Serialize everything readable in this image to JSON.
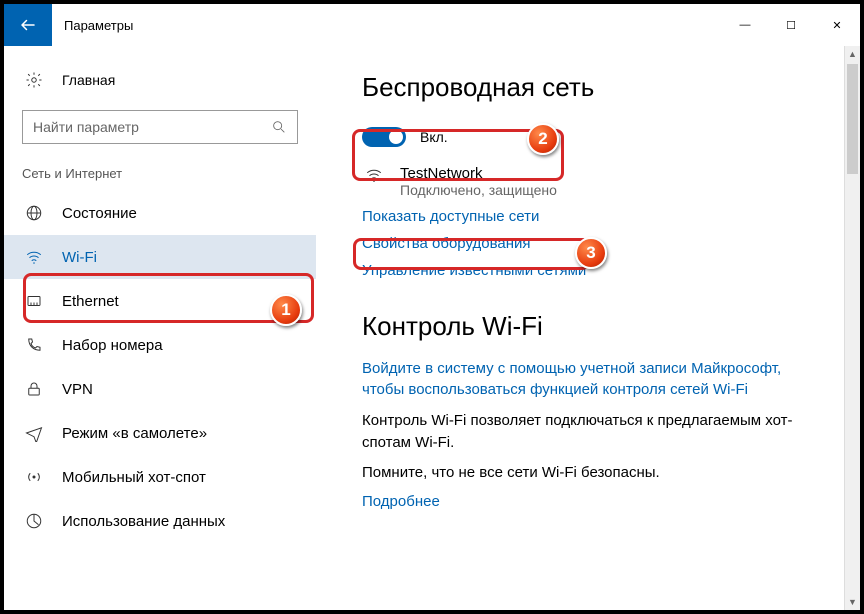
{
  "titlebar": {
    "title": "Параметры"
  },
  "sidebar": {
    "home": "Главная",
    "search_placeholder": "Найти параметр",
    "section": "Сеть и Интернет",
    "items": [
      {
        "label": "Состояние"
      },
      {
        "label": "Wi-Fi"
      },
      {
        "label": "Ethernet"
      },
      {
        "label": "Набор номера"
      },
      {
        "label": "VPN"
      },
      {
        "label": "Режим «в самолете»"
      },
      {
        "label": "Мобильный хот-спот"
      },
      {
        "label": "Использование данных"
      }
    ]
  },
  "main": {
    "heading": "Беспроводная сеть",
    "toggle_label": "Вкл.",
    "network": {
      "name": "TestNetwork",
      "status": "Подключено, защищено"
    },
    "link_available": "Показать доступные сети",
    "link_hardware": "Свойства оборудования",
    "link_known": "Управление известными сетями",
    "heading2": "Контроль Wi-Fi",
    "link_signin": "Войдите в систему с помощью учетной записи Майкрософт, чтобы воспользоваться функцией контроля сетей Wi-Fi",
    "para1": "Контроль Wi-Fi позволяет подключаться к предлагаемым хот-спотам Wi-Fi.",
    "para2": "Помните, что не все сети Wi-Fi безопасны.",
    "link_more": "Подробнее"
  },
  "annotations": {
    "b1": "1",
    "b2": "2",
    "b3": "3"
  }
}
